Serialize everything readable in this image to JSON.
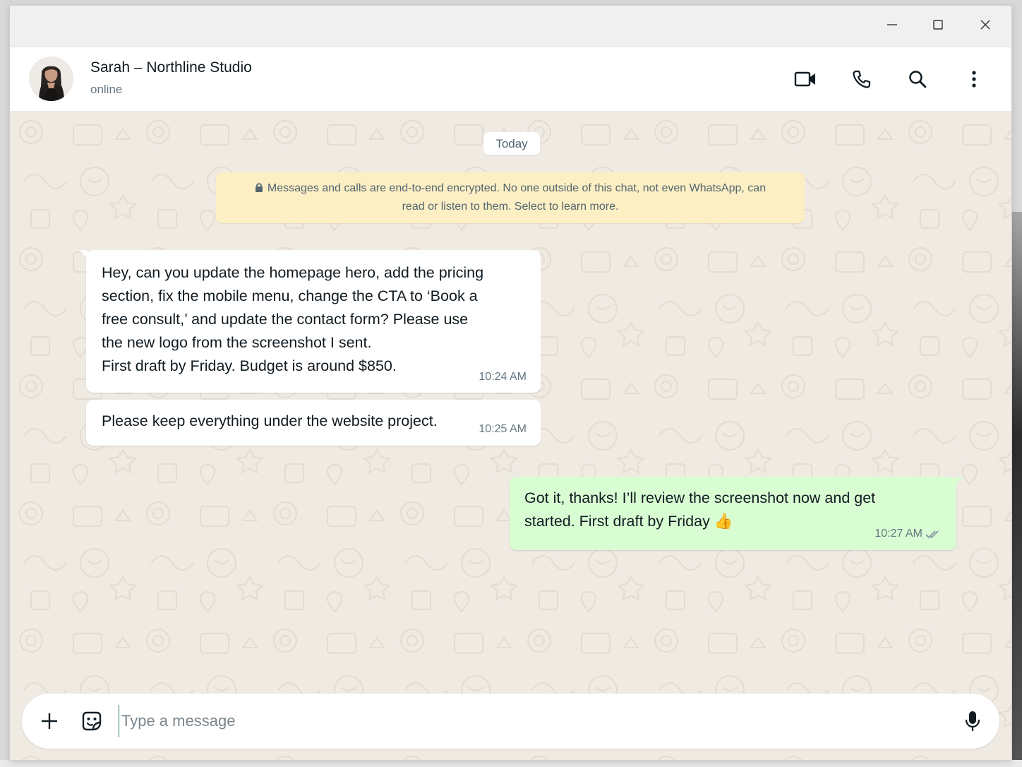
{
  "window": {
    "controls": {
      "minimize": "minimize-icon",
      "maximize": "maximize-icon",
      "close": "close-icon"
    }
  },
  "header": {
    "contact_name": "Sarah – Northline Studio",
    "status": "online",
    "actions": [
      "video-call-icon",
      "voice-call-icon",
      "search-icon",
      "menu-icon"
    ]
  },
  "chat": {
    "date_chip": "Today",
    "encryption_notice": {
      "line1": "Messages and calls are end-to-end encrypted. No one outside of this chat, not even WhatsApp, can",
      "line2": "read or listen to them. Select to learn more."
    },
    "messages": [
      {
        "direction": "incoming",
        "lines": [
          "Hey, can you update the homepage hero, add the pricing",
          "section, fix the mobile menu, change the CTA to ‘Book a",
          "free consult,’ and update the contact form? Please use",
          "the new logo from the screenshot I sent.",
          "First draft by Friday. Budget is around $850."
        ],
        "time": "10:24 AM"
      },
      {
        "direction": "incoming",
        "lines": [
          "Please keep everything under the website project."
        ],
        "time": "10:25 AM"
      },
      {
        "direction": "outgoing",
        "lines": [
          "Got it, thanks! I’ll review the screenshot now and get",
          "started. First draft by Friday 👍"
        ],
        "time": "10:27 AM",
        "status": "read"
      }
    ]
  },
  "composer": {
    "placeholder": "Type a message"
  },
  "colors": {
    "chat_background": "#efeae2",
    "incoming_bubble": "#ffffff",
    "outgoing_bubble": "#d9fdd3",
    "encryption_notice": "#fcefc4",
    "read_tick": "#8696a0"
  }
}
